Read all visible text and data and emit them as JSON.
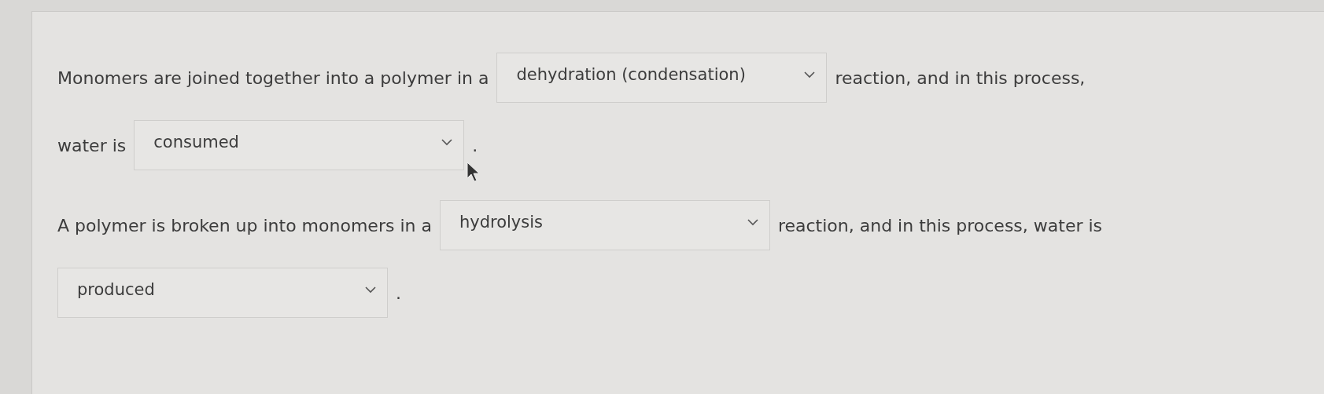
{
  "questions": [
    {
      "lines": [
        [
          {
            "kind": "text",
            "text": "Monomers are joined together into a polymer in a"
          },
          {
            "kind": "select",
            "value": "dehydration (condensation)"
          },
          {
            "kind": "text",
            "text": "reaction, and in this process,"
          }
        ],
        [
          {
            "kind": "text",
            "text": "water is"
          },
          {
            "kind": "select",
            "value": "consumed",
            "cursor": true
          },
          {
            "kind": "text",
            "text": "."
          }
        ]
      ]
    },
    {
      "lines": [
        [
          {
            "kind": "text",
            "text": "A polymer is broken up into monomers in a"
          },
          {
            "kind": "select",
            "value": "hydrolysis"
          },
          {
            "kind": "text",
            "text": "reaction, and in this process, water is"
          }
        ],
        [
          {
            "kind": "select",
            "value": "produced"
          },
          {
            "kind": "text",
            "text": "."
          }
        ]
      ]
    }
  ]
}
